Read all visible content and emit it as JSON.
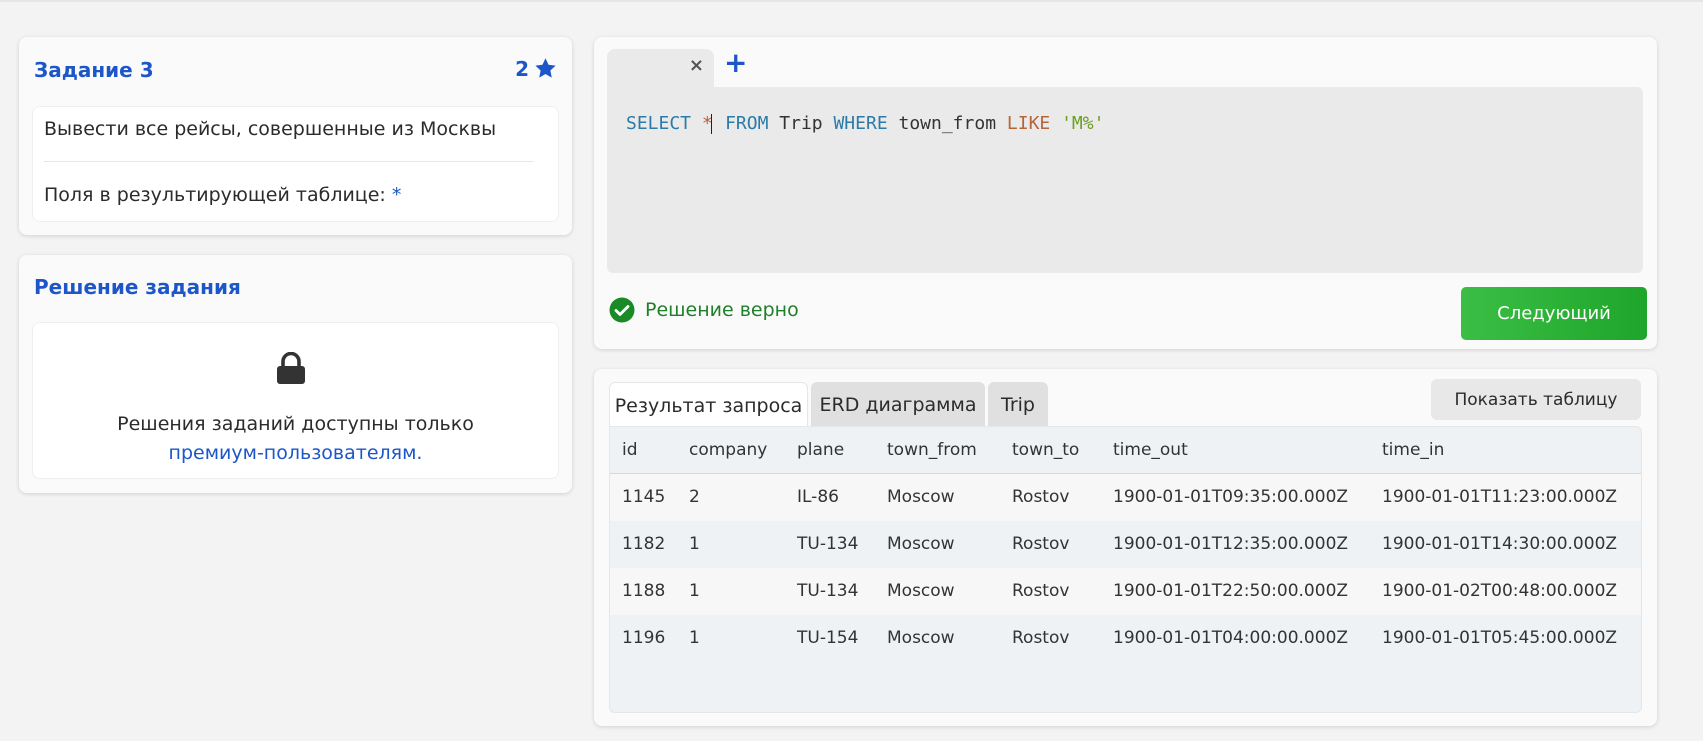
{
  "task": {
    "title": "Задание 3",
    "stars": "2",
    "description": "Вывести все рейсы, совершенные из Москвы",
    "fields_label": "Поля в результирующей таблице:",
    "fields_value": "*"
  },
  "solution": {
    "title": "Решение задания",
    "text_line1": "Решения заданий доступны только",
    "text_link": "премиум-пользователям."
  },
  "editor": {
    "tab_close": "×",
    "tab_add": "+",
    "code": {
      "t1": "SELECT",
      "t2": "*",
      "t3": "FROM",
      "t4": "Trip",
      "t5": "WHERE",
      "t6": "town_from",
      "t7": "LIKE",
      "t8": "'M%'"
    },
    "status": "Решение верно",
    "next_button": "Следующий"
  },
  "result": {
    "tabs": [
      "Результат запроса",
      "ERD диаграмма",
      "Trip"
    ],
    "show_table_button": "Показать таблицу",
    "columns": [
      "id",
      "company",
      "plane",
      "town_from",
      "town_to",
      "time_out",
      "time_in"
    ],
    "rows": [
      [
        "1145",
        "2",
        "IL-86",
        "Moscow",
        "Rostov",
        "1900-01-01T09:35:00.000Z",
        "1900-01-01T11:23:00.000Z"
      ],
      [
        "1182",
        "1",
        "TU-134",
        "Moscow",
        "Rostov",
        "1900-01-01T12:35:00.000Z",
        "1900-01-01T14:30:00.000Z"
      ],
      [
        "1188",
        "1",
        "TU-134",
        "Moscow",
        "Rostov",
        "1900-01-01T22:50:00.000Z",
        "1900-01-02T00:48:00.000Z"
      ],
      [
        "1196",
        "1",
        "TU-154",
        "Moscow",
        "Rostov",
        "1900-01-01T04:00:00.000Z",
        "1900-01-01T05:45:00.000Z"
      ]
    ]
  },
  "colors": {
    "accent_blue": "#1d56c9",
    "success_green": "#1f7f2a",
    "button_green": "#2bb236"
  },
  "icons": {
    "star": "star-icon",
    "lock": "lock-icon",
    "success": "check-circle-icon",
    "close": "close-icon",
    "add": "plus-icon"
  }
}
